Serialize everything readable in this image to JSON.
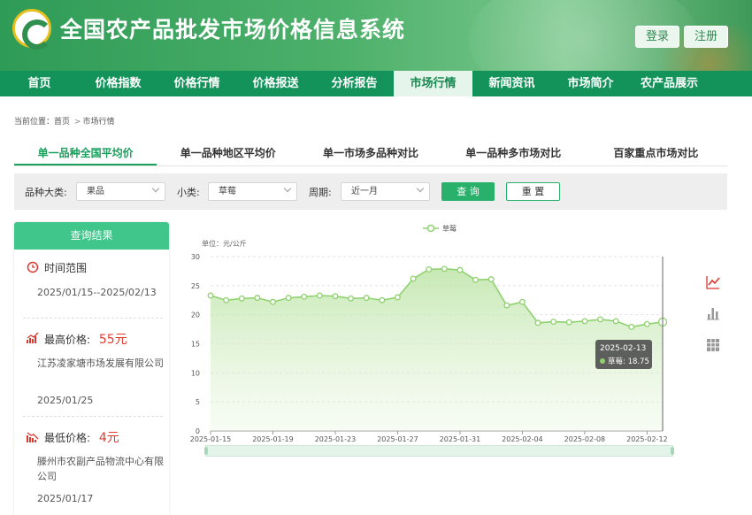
{
  "header": {
    "site_title": "全国农产品批发市场价格信息系统",
    "login_label": "登录",
    "register_label": "注册"
  },
  "nav": {
    "items": [
      {
        "label": "首页"
      },
      {
        "label": "价格指数"
      },
      {
        "label": "价格行情"
      },
      {
        "label": "价格报送"
      },
      {
        "label": "分析报告"
      },
      {
        "label": "市场行情"
      },
      {
        "label": "新闻资讯"
      },
      {
        "label": "市场简介"
      },
      {
        "label": "农产品展示"
      }
    ],
    "active_index": 5
  },
  "breadcrumb": {
    "prefix": "当前位置：",
    "home": "首页",
    "separator": ">",
    "current": "市场行情"
  },
  "tabs": {
    "items": [
      {
        "label": "单一品种全国平均价"
      },
      {
        "label": "单一品种地区平均价"
      },
      {
        "label": "单一市场多品种对比"
      },
      {
        "label": "单一品种多市场对比"
      },
      {
        "label": "百家重点市场对比"
      }
    ],
    "active_index": 0
  },
  "filter": {
    "category_label": "品种大类:",
    "category_value": "果品",
    "subcategory_label": "小类:",
    "subcategory_value": "草莓",
    "period_label": "周期:",
    "period_value": "近一月",
    "query_label": "查 询",
    "reset_label": "重 置"
  },
  "result": {
    "title": "查询结果",
    "time_range_label": "时间范围",
    "time_range_value": "2025/01/15--2025/02/13",
    "max_label": "最高价格:",
    "max_price": "55元",
    "max_market": "江苏凌家塘市场发展有限公司",
    "max_date": "2025/01/25",
    "min_label": "最低价格:",
    "min_price": "4元",
    "min_market": "滕州市农副产品物流中心有限公司",
    "min_date": "2025/01/17"
  },
  "colors": {
    "brand_green": "#13935a",
    "accent_green": "#29b06b",
    "line_color": "#8fd16f",
    "price_red": "#e03a2f"
  },
  "chart_data": {
    "type": "area",
    "unit_label": "单位：元/公斤",
    "legend": [
      "草莓"
    ],
    "legend_position": "top-center",
    "ylim": [
      0,
      30
    ],
    "yticks": [
      0,
      5,
      10,
      15,
      20,
      25,
      30
    ],
    "x_tick_labels": [
      "2025-01-15",
      "2025-01-19",
      "2025-01-23",
      "2025-01-27",
      "2025-01-31",
      "2025-02-04",
      "2025-02-08",
      "2025-02-12"
    ],
    "grid": true,
    "x": [
      "2025-01-15",
      "2025-01-16",
      "2025-01-17",
      "2025-01-18",
      "2025-01-19",
      "2025-01-20",
      "2025-01-21",
      "2025-01-22",
      "2025-01-23",
      "2025-01-24",
      "2025-01-25",
      "2025-01-26",
      "2025-01-27",
      "2025-01-28",
      "2025-01-29",
      "2025-01-30",
      "2025-01-31",
      "2025-02-01",
      "2025-02-02",
      "2025-02-03",
      "2025-02-04",
      "2025-02-05",
      "2025-02-06",
      "2025-02-07",
      "2025-02-08",
      "2025-02-09",
      "2025-02-10",
      "2025-02-11",
      "2025-02-12",
      "2025-02-13"
    ],
    "series": [
      {
        "name": "草莓",
        "values": [
          23.3,
          22.5,
          22.8,
          22.9,
          22.2,
          22.9,
          23.1,
          23.3,
          23.2,
          22.8,
          22.9,
          22.5,
          23.0,
          26.2,
          27.8,
          27.9,
          27.7,
          26.0,
          26.1,
          21.6,
          22.2,
          18.6,
          18.8,
          18.7,
          18.9,
          19.2,
          18.9,
          17.9,
          18.4,
          18.75
        ]
      }
    ],
    "tooltip": {
      "date": "2025-02-13",
      "series": "草莓",
      "value": "18.75"
    }
  }
}
